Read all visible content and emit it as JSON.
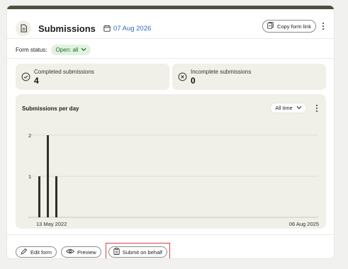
{
  "header": {
    "title": "Submissions",
    "date": "07 Aug 2026",
    "copy_link_label": "Copy form link"
  },
  "form_status": {
    "label": "Form status:",
    "value": "Open: all"
  },
  "stats": {
    "completed": {
      "label": "Completed submissions",
      "value": "4"
    },
    "incomplete": {
      "label": "Incomplete submissions",
      "value": "0"
    }
  },
  "chart": {
    "title": "Submissions per day",
    "range_label": "All time"
  },
  "chart_data": {
    "type": "bar",
    "title": "Submissions per day",
    "x_start_label": "13 May 2022",
    "x_end_label": "06 Aug 2025",
    "y_ticks": [
      1,
      2
    ],
    "ylim": [
      0,
      2
    ],
    "values": [
      1,
      2,
      1
    ],
    "grid": true
  },
  "footer": {
    "edit_label": "Edit form",
    "preview_label": "Preview",
    "behalf_label": "Submit on behalf"
  },
  "colors": {
    "accent_bar": "#4b5140",
    "date_blue": "#2f66c7",
    "status_green_bg": "#e1f3df",
    "status_green_text": "#1f6a2a",
    "bar": "#2e3226",
    "highlight_border": "#d94141"
  },
  "icons": {
    "header": "document-icon",
    "date": "calendar-icon",
    "copy": "copy-link-icon",
    "completed": "check-circle-icon",
    "incomplete": "x-circle-icon",
    "edit": "pencil-icon",
    "preview": "eye-icon",
    "behalf": "clipboard-icon"
  }
}
